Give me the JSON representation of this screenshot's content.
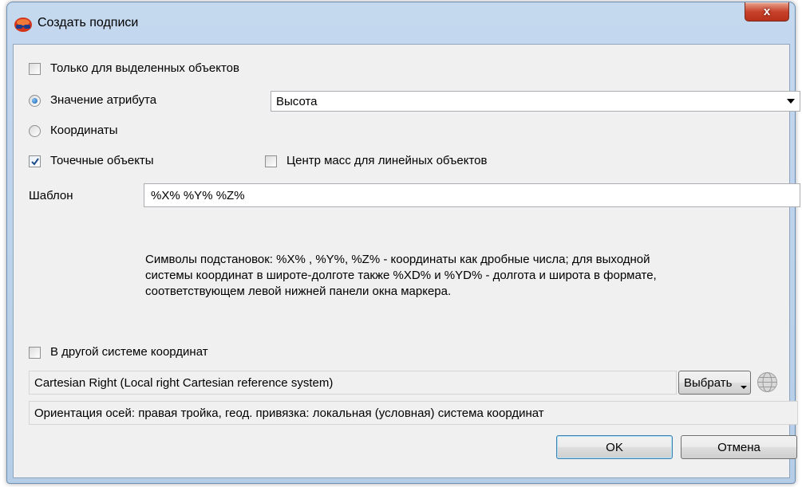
{
  "window": {
    "title": "Создать подписи",
    "close_label": "x"
  },
  "options": {
    "only_selected": "Только для выделенных объектов",
    "attribute_value": "Значение атрибута",
    "attribute_selected": "Высота",
    "coordinates": "Координаты",
    "point_objects": "Точечные объекты",
    "center_mass": "Центр масс для линейных объектов"
  },
  "template": {
    "label": "Шаблон",
    "value": "%X% %Y% %Z%"
  },
  "hint": {
    "line1": "Символы подстановок: %X% , %Y%, %Z% - координаты как дробные числа; для выходной",
    "line2": "системы координат в широте-долготе также %XD% и %YD% - долгота и широта в формате,",
    "line3": "соответствующем левой нижней панели  окна маркера."
  },
  "other_system": {
    "label": "В другой системе координат",
    "system_name": "Cartesian Right (Local right Cartesian reference system)",
    "select_label": "Выбрать",
    "orientation": "Ориентация осей: правая тройка, геод. привязка: локальная (условная) система координат"
  },
  "buttons": {
    "ok": "OK",
    "cancel": "Отмена"
  },
  "states": {
    "only_selected": false,
    "attribute_value": true,
    "coordinates": false,
    "point_objects": true,
    "center_mass": false,
    "other_system": false
  },
  "colors": {
    "close_button": "#c8432c",
    "checked_accent": "#1d5ea8",
    "default_button_border": "#3c7fb1"
  }
}
